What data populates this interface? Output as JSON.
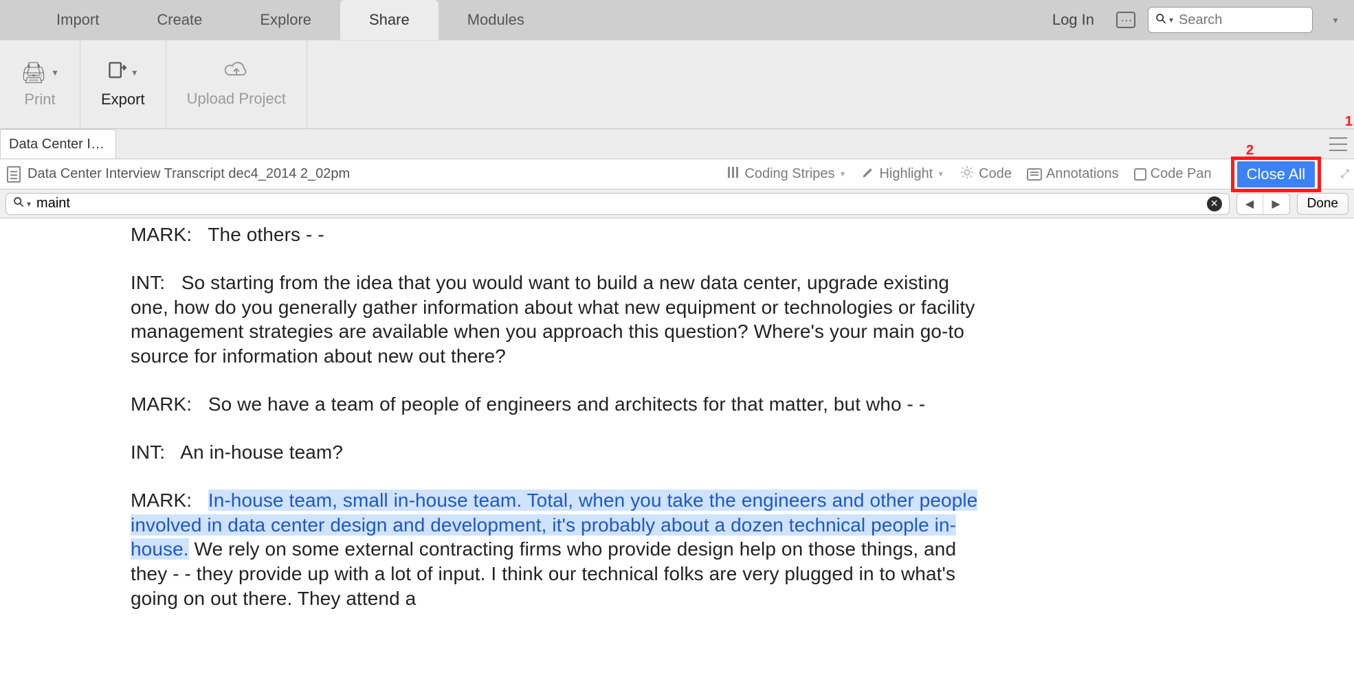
{
  "tabbar": {
    "tabs": [
      "Import",
      "Create",
      "Explore",
      "Share",
      "Modules"
    ],
    "active_index": 3,
    "login": "Log In",
    "search_placeholder": "Search"
  },
  "ribbon": {
    "print": "Print",
    "export": "Export",
    "upload": "Upload Project"
  },
  "doc": {
    "tab_label": "Data Center I…",
    "title": "Data Center Interview Transcript dec4_2014 2_02pm",
    "tools": {
      "coding_stripes": "Coding Stripes",
      "highlight": "Highlight",
      "code": "Code",
      "annotations": "Annotations",
      "code_panel": "Code Pan"
    },
    "close_all": "Close All",
    "markers": {
      "one": "1",
      "two": "2"
    }
  },
  "find": {
    "query": "maint",
    "done": "Done"
  },
  "transcript": {
    "p1_label": "MARK:  ",
    "p1_text": "The others - -",
    "p2_label": "INT:  ",
    "p2_text": "So starting from the idea that you would want to build a new data center, upgrade existing one, how do you generally gather information about what new equipment or technologies or facility management strategies are available when you approach this question?  Where's your main go-to source for information about new out there?",
    "p3_label": "MARK:  ",
    "p3_text": "So we have a team of people of engineers and architects for that matter, but who - -",
    "p4_label": "INT:  ",
    "p4_text": "An in-house team?",
    "p5_label": "MARK:  ",
    "p5_hl": "In-house team, small in-house team.  Total, when you take the engineers and other people involved in data center design and development, it's probably about a dozen technical people in-house.",
    "p5_rest": "  We rely on some external contracting firms who provide design help on those things, and they - - they provide up with a lot of input.  I think our technical folks are very plugged in to what's going on out there.  They attend a"
  }
}
